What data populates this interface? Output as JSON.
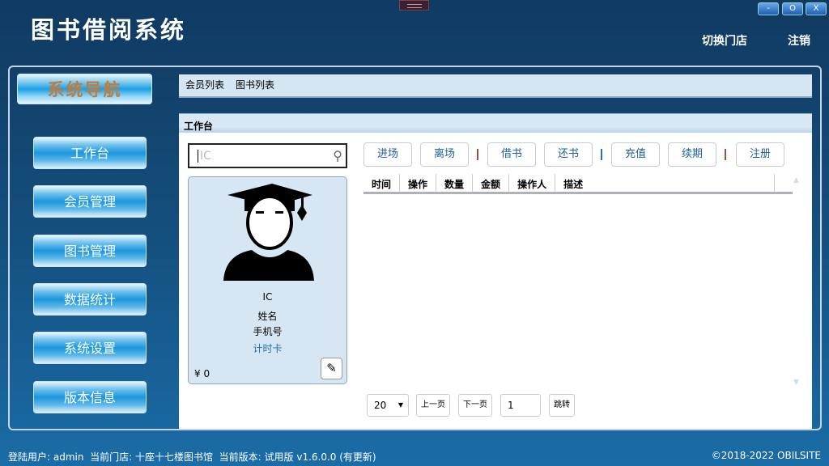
{
  "app": {
    "title": "图书借阅系统",
    "window_controls": [
      "-",
      "O",
      "X"
    ],
    "links": {
      "switch_store": "切换门店",
      "logout": "注销"
    }
  },
  "sidebar": {
    "header": "系统导航",
    "items": [
      {
        "label": "工作台"
      },
      {
        "label": "会员管理"
      },
      {
        "label": "图书管理"
      },
      {
        "label": "数据统计"
      },
      {
        "label": "系统设置"
      },
      {
        "label": "版本信息"
      }
    ]
  },
  "tabs": [
    {
      "label": "会员列表"
    },
    {
      "label": "图书列表"
    }
  ],
  "workspace": {
    "title": "工作台",
    "search": {
      "placeholder": "IC"
    },
    "member_card": {
      "ic": "IC",
      "name": "姓名",
      "phone": "手机号",
      "card_type": "计时卡",
      "balance": "¥ 0"
    },
    "actions": [
      "进场",
      "离场",
      "借书",
      "还书",
      "充值",
      "续期",
      "注册"
    ],
    "columns": [
      "时间",
      "操作",
      "数量",
      "金额",
      "操作人",
      "描述"
    ],
    "pagination": {
      "page_size": "20",
      "prev": "上一页",
      "next": "下一页",
      "page": "1",
      "jump": "跳转"
    }
  },
  "status": {
    "user_label": "登陆用户:",
    "user": "admin",
    "store_label": "当前门店:",
    "store": "十座十七楼图书馆",
    "version_label": "当前版本:",
    "version": "试用版 v1.6.0.0 (有更新)",
    "copyright": "©2018-2022 OBILSITE"
  }
}
